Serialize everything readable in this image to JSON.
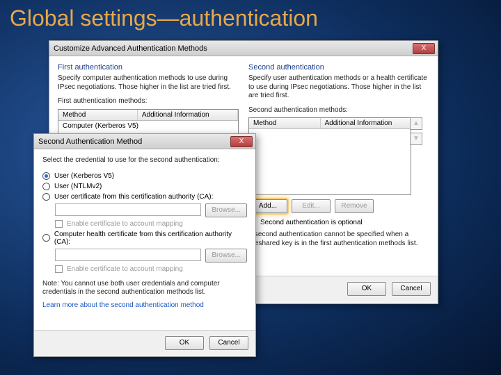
{
  "slide": {
    "title": "Global settings—authentication"
  },
  "dlg1": {
    "title": "Customize Advanced Authentication Methods",
    "close": "X",
    "first": {
      "heading": "First authentication",
      "desc": "Specify computer authentication methods to use during IPsec negotiations. Those higher in the list are tried first.",
      "label": "First authentication methods:",
      "col_method": "Method",
      "col_info": "Additional Information",
      "row1": "Computer (Kerberos V5)"
    },
    "second": {
      "heading": "Second authentication",
      "desc": "Specify user authentication methods or a health certificate to use during IPsec negotiations. Those higher in the list are tried first.",
      "label": "Second authentication methods:",
      "col_method": "Method",
      "col_info": "Additional Information",
      "btn_add": "Add...",
      "btn_edit": "Edit...",
      "btn_remove": "Remove",
      "optional": "Second authentication is optional",
      "warn": "A second authentication cannot be specified when a preshared key is in the first authentication methods list."
    },
    "ok": "OK",
    "cancel": "Cancel"
  },
  "dlg2": {
    "title": "Second Authentication Method",
    "close": "X",
    "prompt": "Select the credential to use for the second authentication:",
    "opt1": "User (Kerberos V5)",
    "opt2": "User (NTLMv2)",
    "opt3": "User certificate from this certification authority (CA):",
    "browse": "Browse...",
    "map1": "Enable certificate to account mapping",
    "opt4": "Computer health certificate from this certification authority (CA):",
    "map2": "Enable certificate to account mapping",
    "note": "Note: You cannot use both user credentials and computer credentials in the second authentication methods list.",
    "link": "Learn more about the second authentication method",
    "ok": "OK",
    "cancel": "Cancel"
  }
}
